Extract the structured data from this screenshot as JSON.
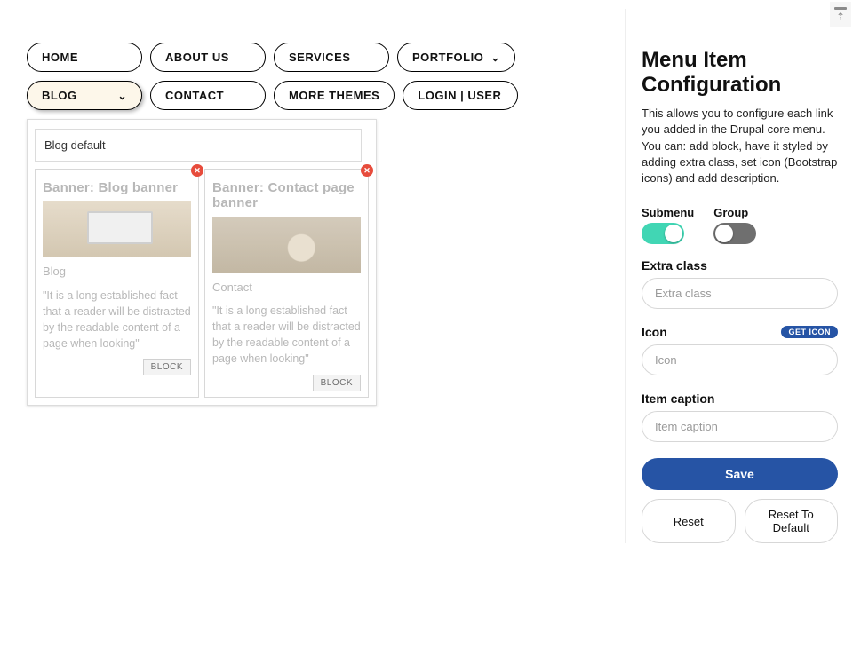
{
  "nav": [
    {
      "label": "HOME",
      "has_submenu": false,
      "selected": false
    },
    {
      "label": "ABOUT US",
      "has_submenu": false,
      "selected": false
    },
    {
      "label": "SERVICES",
      "has_submenu": false,
      "selected": false
    },
    {
      "label": "PORTFOLIO",
      "has_submenu": true,
      "selected": false
    },
    {
      "label": "BLOG",
      "has_submenu": true,
      "selected": true
    },
    {
      "label": "CONTACT",
      "has_submenu": false,
      "selected": false
    },
    {
      "label": "MORE THEMES",
      "has_submenu": false,
      "selected": false
    },
    {
      "label": "LOGIN | USER",
      "has_submenu": false,
      "selected": false
    }
  ],
  "panel": {
    "search_value": "Blog default",
    "cards": [
      {
        "title": "Banner: Blog banner",
        "link_text": "Blog",
        "thumb_style": "laptop",
        "description": "\"It is a long established fact that a reader will be distracted by the readable content of a page when looking\"",
        "button": "BLOCK"
      },
      {
        "title": "Banner: Contact page banner",
        "link_text": "Contact",
        "thumb_style": "office",
        "description": "\"It is a long established fact that a reader will be distracted by the readable content of a page when looking\"",
        "button": "BLOCK"
      }
    ]
  },
  "config": {
    "title": "Menu Item Configuration",
    "description": "This allows you to configure each link you added in the Drupal core menu. You can: add block, have it styled by adding extra class, set icon (Bootstrap icons) and add description.",
    "toggles": {
      "submenu": {
        "label": "Submenu",
        "on": true
      },
      "group": {
        "label": "Group",
        "on": false
      }
    },
    "fields": {
      "extra_class": {
        "label": "Extra class",
        "placeholder": "Extra class",
        "value": ""
      },
      "icon": {
        "label": "Icon",
        "placeholder": "Icon",
        "value": "",
        "get_icon_label": "GET ICON"
      },
      "caption": {
        "label": "Item caption",
        "placeholder": "Item caption",
        "value": ""
      }
    },
    "buttons": {
      "save": "Save",
      "reset": "Reset",
      "reset_default": "Reset To Default"
    }
  },
  "close_glyph": "✕"
}
